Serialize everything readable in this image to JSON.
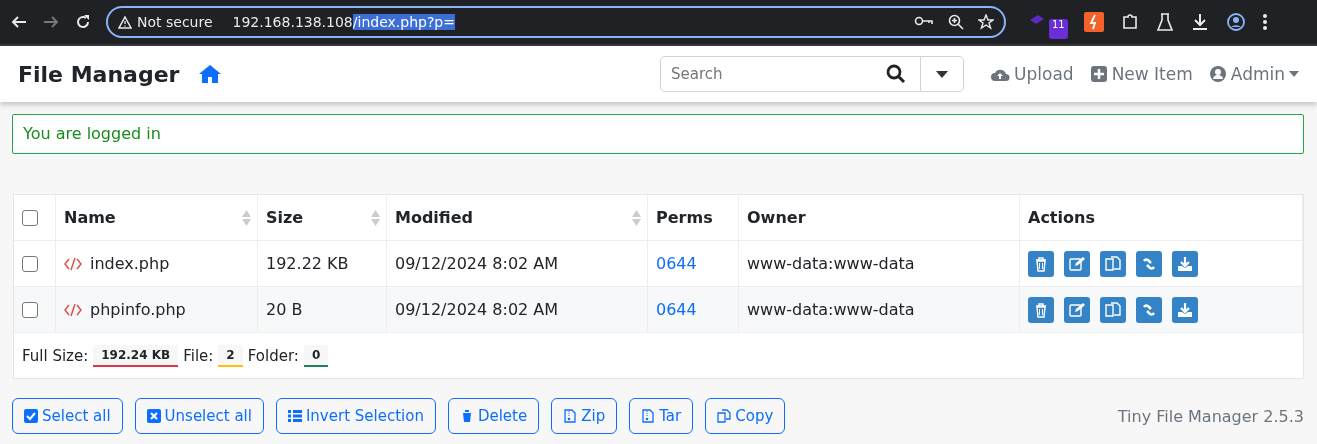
{
  "browser": {
    "security": "Not secure",
    "url_host": "192.168.138.108",
    "url_path": "/index.php?p=",
    "url_path_selected": true,
    "extension_badge": "11"
  },
  "navbar": {
    "title": "File Manager",
    "search": {
      "placeholder": "Search"
    },
    "actions": [
      {
        "kind": "upload",
        "label": "Upload"
      },
      {
        "kind": "new",
        "label": "New Item"
      },
      {
        "kind": "user",
        "label": "Admin"
      }
    ]
  },
  "alert": {
    "text": "You are logged in"
  },
  "table": {
    "all_checked": false,
    "columns": [
      {
        "label": "Name",
        "sortable": true
      },
      {
        "label": "Size",
        "sortable": true
      },
      {
        "label": "Modified",
        "sortable": true
      },
      {
        "label": "Perms",
        "sortable": false
      },
      {
        "label": "Owner",
        "sortable": false
      },
      {
        "label": "Actions",
        "sortable": false
      }
    ],
    "rows": [
      {
        "checked": false,
        "name": "index.php",
        "size": "192.22 KB",
        "modified": "09/12/2024 8:02 AM",
        "perms": "0644",
        "owner": "www-data:www-data"
      },
      {
        "checked": false,
        "name": "phpinfo.php",
        "size": "20 B",
        "modified": "09/12/2024 8:02 AM",
        "perms": "0644",
        "owner": "www-data:www-data"
      }
    ],
    "summary": [
      {
        "label": "Full Size:",
        "value": "192.24 KB",
        "color": "#dc3545"
      },
      {
        "label": "File:",
        "value": "2",
        "color": "#ffc107"
      },
      {
        "label": "Folder:",
        "value": "0",
        "color": "#198754"
      }
    ]
  },
  "buttons": [
    {
      "kind": "check",
      "label": "Select all"
    },
    {
      "kind": "cross",
      "label": "Unselect all"
    },
    {
      "kind": "list",
      "label": "Invert Selection"
    },
    {
      "kind": "trash",
      "label": "Delete"
    },
    {
      "kind": "zip",
      "label": "Zip"
    },
    {
      "kind": "zip",
      "label": "Tar"
    },
    {
      "kind": "copy",
      "label": "Copy"
    }
  ],
  "version": "Tiny File Manager 2.5.3"
}
